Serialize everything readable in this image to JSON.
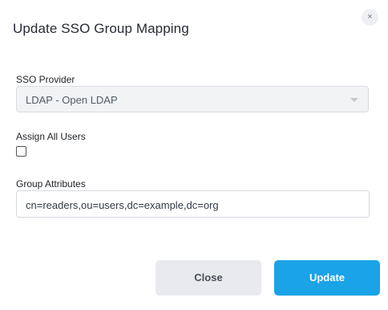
{
  "dialog": {
    "title": "Update SSO Group Mapping",
    "close_icon": "close-icon",
    "close_glyph": "×"
  },
  "form": {
    "sso_provider": {
      "label": "SSO Provider",
      "selected": "LDAP - Open LDAP",
      "disabled": true
    },
    "assign_all_users": {
      "label": "Assign All Users",
      "checked": false
    },
    "group_attributes": {
      "label": "Group Attributes",
      "value": "cn=readers,ou=users,dc=example,dc=org"
    }
  },
  "actions": {
    "close_label": "Close",
    "update_label": "Update"
  },
  "colors": {
    "primary": "#1aa3e6",
    "secondary": "#e8eaed"
  }
}
